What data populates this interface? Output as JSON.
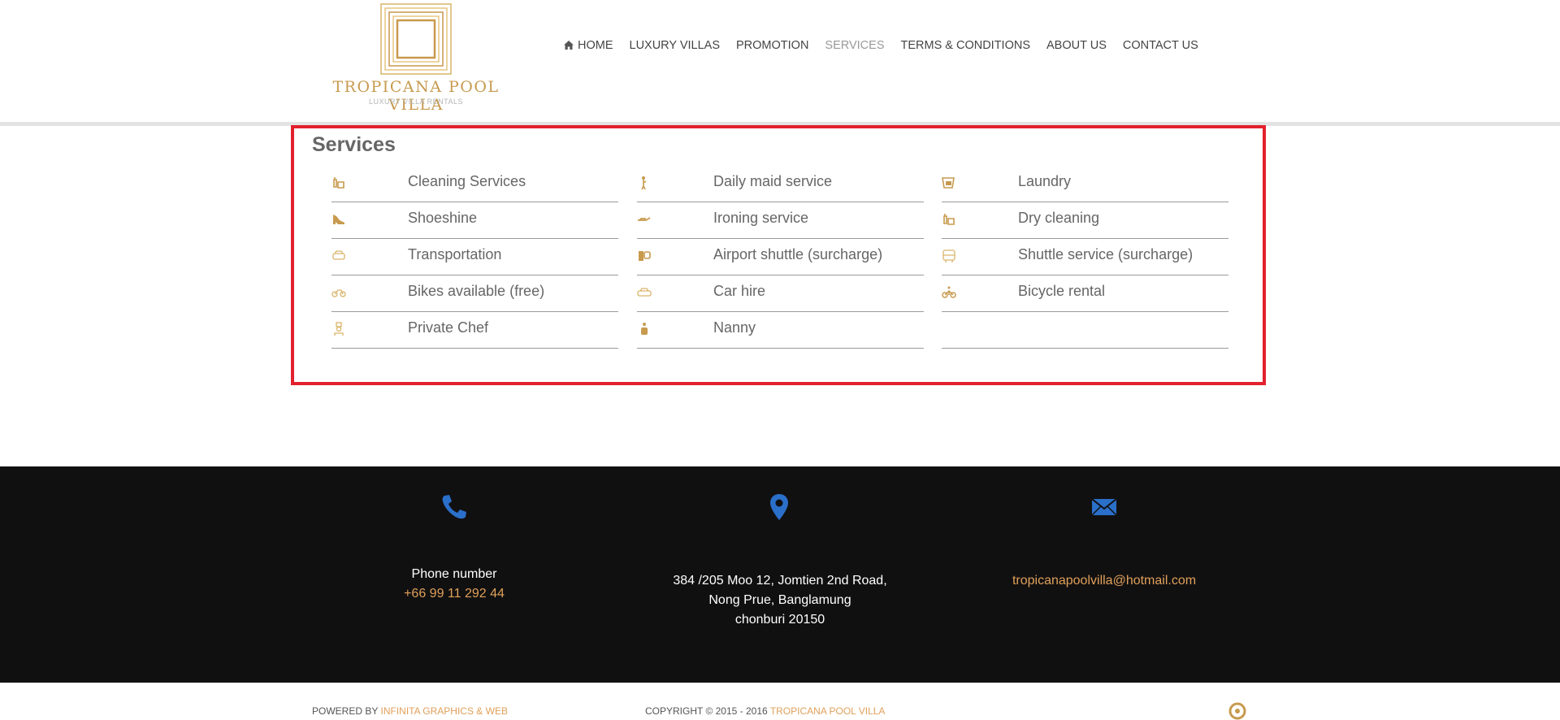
{
  "brand": {
    "title": "TROPICANA POOL VILLA",
    "subtitle": "LUXURY VILLA RENTALS",
    "gold": "#c79a4e"
  },
  "nav": {
    "items": [
      {
        "label": "HOME",
        "icon": "home-icon"
      },
      {
        "label": "LUXURY VILLAS"
      },
      {
        "label": "PROMOTION"
      },
      {
        "label": "SERVICES",
        "active": true
      },
      {
        "label": "TERMS & CONDITIONS"
      },
      {
        "label": "ABOUT US"
      },
      {
        "label": "CONTACT US"
      }
    ]
  },
  "services": {
    "title": "Services",
    "columns": [
      [
        {
          "label": "Cleaning Services",
          "icon": "cleaning-icon"
        },
        {
          "label": "Shoeshine",
          "icon": "shoe-icon"
        },
        {
          "label": "Transportation",
          "icon": "car-icon"
        },
        {
          "label": "Bikes available (free)",
          "icon": "bike-icon"
        },
        {
          "label": "Private Chef",
          "icon": "chef-icon"
        }
      ],
      [
        {
          "label": "Daily maid service",
          "icon": "maid-icon"
        },
        {
          "label": "Ironing service",
          "icon": "iron-icon"
        },
        {
          "label": "Airport shuttle (surcharge)",
          "icon": "shuttle-icon"
        },
        {
          "label": "Car hire",
          "icon": "car-hire-icon"
        },
        {
          "label": "Nanny",
          "icon": "nanny-icon"
        }
      ],
      [
        {
          "label": "Laundry",
          "icon": "laundry-icon"
        },
        {
          "label": "Dry cleaning",
          "icon": "dry-cleaning-icon"
        },
        {
          "label": "Shuttle service (surcharge)",
          "icon": "bus-icon"
        },
        {
          "label": "Bicycle rental",
          "icon": "bicycle-icon"
        },
        {
          "label": "",
          "icon": ""
        }
      ]
    ]
  },
  "footer": {
    "phone": {
      "heading": "Phone number",
      "value": "+66 99 11 292 44",
      "icon": "phone-icon"
    },
    "address": {
      "line1": "384 /205 Moo 12, Jomtien 2nd Road,",
      "line2": "Nong Prue, Banglamung",
      "line3": "chonburi 20150",
      "icon": "map-pin-icon"
    },
    "email": {
      "value": "tropicanapoolvilla@hotmail.com",
      "icon": "envelope-icon"
    },
    "icon_color": "#2a6fc9",
    "link_color": "#e0a05a"
  },
  "bottom": {
    "powered_prefix": "POWERED BY",
    "powered_link": "INFINITA GRAPHICS & WEB",
    "copyright_prefix": "COPYRIGHT © 2015 - 2016",
    "copyright_link": "TROPICANA POOL VILLA"
  }
}
